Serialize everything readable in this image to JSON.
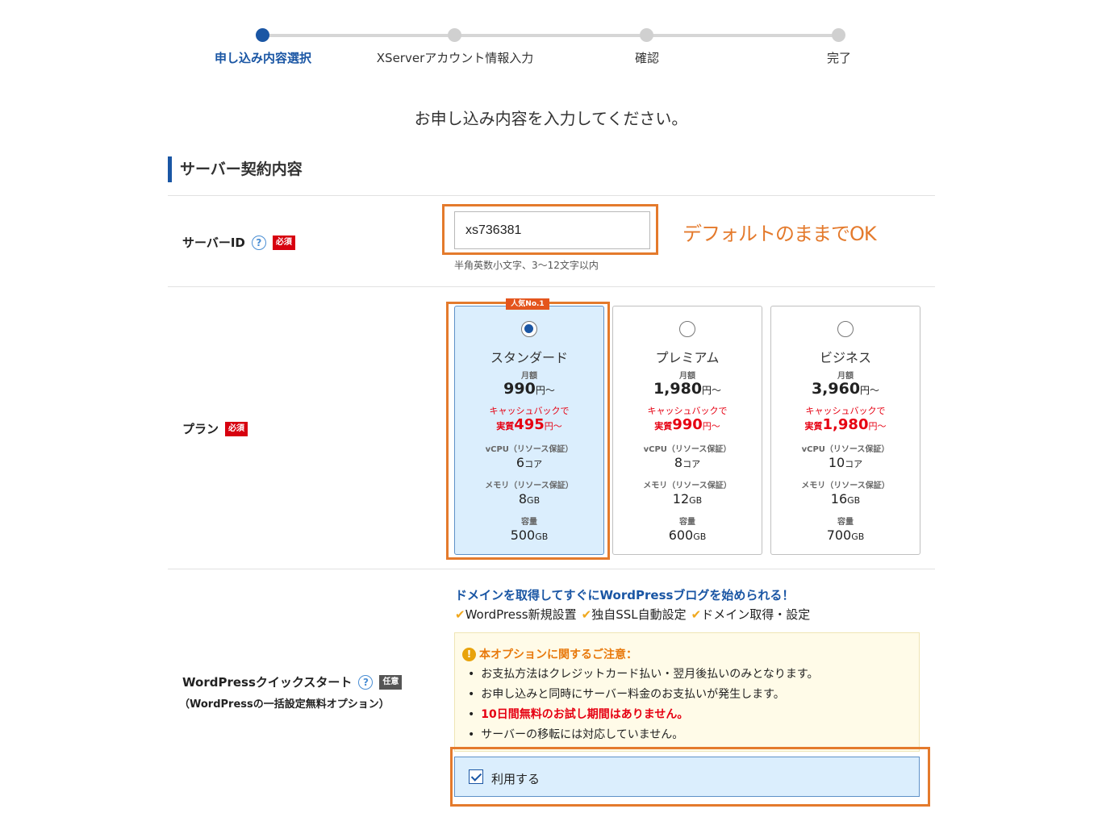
{
  "stepper": {
    "steps": [
      {
        "label": "申し込み内容選択",
        "active": true
      },
      {
        "label": "XServerアカウント情報入力",
        "active": false
      },
      {
        "label": "確認",
        "active": false
      },
      {
        "label": "完了",
        "active": false
      }
    ]
  },
  "page_heading": "お申し込み内容を入力してください。",
  "section_title": "サーバー契約内容",
  "server_id": {
    "label": "サーバーID",
    "required_badge": "必須",
    "value": "xs736381",
    "hint": "半角英数小文字、3～12文字以内",
    "annotation": "デフォルトのままでOK"
  },
  "plan": {
    "label": "プラン",
    "required_badge": "必須",
    "ribbon": "人気No.1",
    "monthly_label": "月額",
    "cashback_label": "キャッシュバックで",
    "effective_label": "実質",
    "yen_suffix": "円～",
    "vcpu_label": "vCPU（リソース保証）",
    "core_unit": "コア",
    "memory_label": "メモリ（リソース保証）",
    "gb_unit": "GB",
    "capacity_label": "容量",
    "items": [
      {
        "name": "スタンダード",
        "price": "990",
        "effective": "495",
        "vcpu": "6",
        "memory": "8",
        "capacity": "500",
        "selected": true
      },
      {
        "name": "プレミアム",
        "price": "1,980",
        "effective": "990",
        "vcpu": "8",
        "memory": "12",
        "capacity": "600",
        "selected": false
      },
      {
        "name": "ビジネス",
        "price": "3,960",
        "effective": "1,980",
        "vcpu": "10",
        "memory": "16",
        "capacity": "700",
        "selected": false
      }
    ]
  },
  "wordpress": {
    "label": "WordPressクイックスタート",
    "optional_badge": "任意",
    "sublabel": "（WordPressの一括設定無料オプション）",
    "promo_title": "ドメインを取得してすぐにWordPressブログを始められる！",
    "features": [
      "WordPress新規設置",
      "独自SSL自動設定",
      "ドメイン取得・設定"
    ],
    "notice_title": "本オプションに関するご注意：",
    "notice_items": [
      {
        "text": "お支払方法はクレジットカード払い・翌月後払いのみとなります。",
        "red": false
      },
      {
        "text": "お申し込みと同時にサーバー料金のお支払いが発生します。",
        "red": false
      },
      {
        "text": "10日間無料のお試し期間はありません。",
        "red": true
      },
      {
        "text": "サーバーの移転には対応していません。",
        "red": false
      }
    ],
    "use_label": "利用する",
    "use_checked": true
  },
  "colors": {
    "accent": "#1a56a4",
    "highlight": "#e47a2c",
    "danger": "#e60012"
  }
}
